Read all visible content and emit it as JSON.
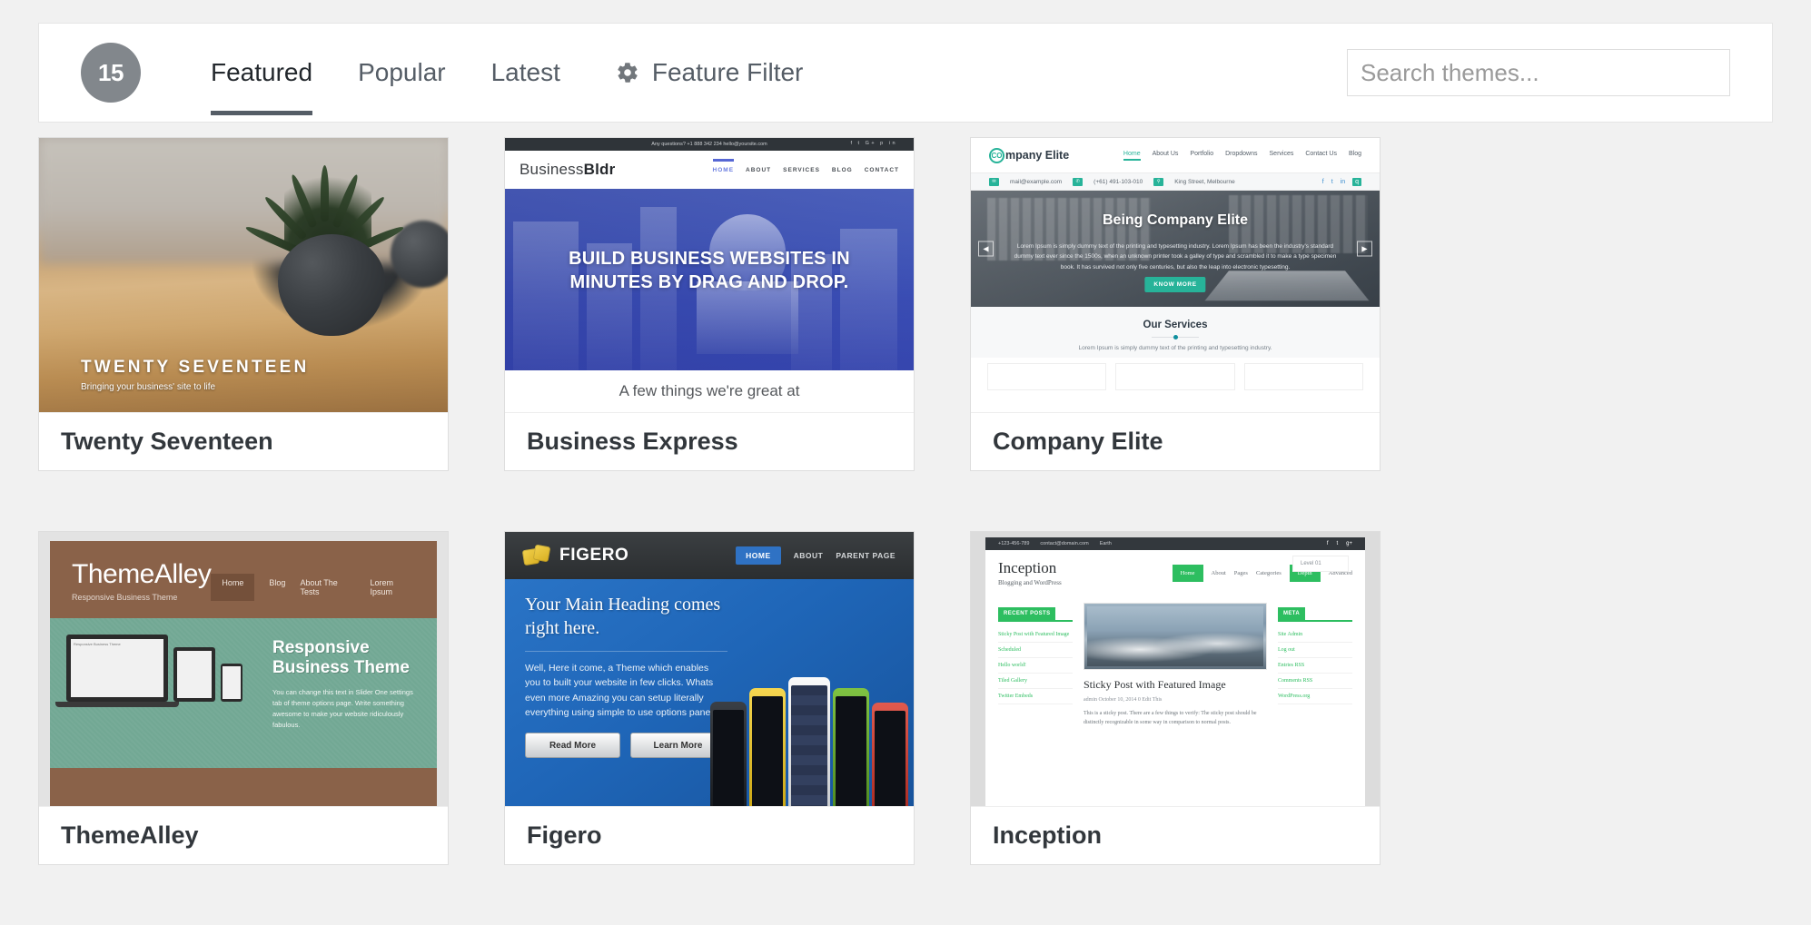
{
  "header": {
    "count": "15",
    "tabs": [
      {
        "label": "Featured",
        "active": true
      },
      {
        "label": "Popular",
        "active": false
      },
      {
        "label": "Latest",
        "active": false
      }
    ],
    "feature_filter_label": "Feature Filter",
    "gear_icon": "gear-icon",
    "search": {
      "value": "",
      "placeholder": "Search themes..."
    }
  },
  "themes": [
    {
      "name": "Twenty Seventeen",
      "preview": {
        "overlay_title": "TWENTY SEVENTEEN",
        "overlay_tagline": "Bringing your business' site to life"
      }
    },
    {
      "name": "Business Express",
      "preview": {
        "topbar": "Any questions?   +1 888 342 234    hello@yoursite.com",
        "social": "f  t  G+  p  in",
        "logo_light": "Business",
        "logo_bold": "Bldr",
        "nav": [
          "HOME",
          "ABOUT",
          "SERVICES",
          "BLOG",
          "CONTACT"
        ],
        "hero_line1": "BUILD BUSINESS WEBSITES IN",
        "hero_line2": "MINUTES BY DRAG AND DROP.",
        "subheading": "A few things we're great at"
      }
    },
    {
      "name": "Company Elite",
      "preview": {
        "logo_badge": "CO",
        "logo_rest": "mpany Elite",
        "nav": [
          "Home",
          "About Us",
          "Portfolio",
          "Dropdowns",
          "Services",
          "Contact Us",
          "Blog"
        ],
        "info_email": "mail@example.com",
        "info_phone": "(+61) 491-103-010",
        "info_address": "King Street, Melbourne",
        "hero_title": "Being Company Elite",
        "hero_body": "Lorem Ipsum is simply dummy text of the printing and typesetting industry. Lorem Ipsum has been the industry's standard dummy text ever since the 1500s, when an unknown printer took a galley of type and scrambled it to make a type specimen book. It has survived not only five centuries, but also the leap into electronic typesetting.",
        "hero_button": "KNOW MORE",
        "arrow_prev": "◀",
        "arrow_next": "▶",
        "services_title": "Our Services",
        "services_body": "Lorem Ipsum is simply dummy text of the printing and typesetting industry."
      }
    },
    {
      "name": "ThemeAlley",
      "preview": {
        "logo": "ThemeAlley",
        "tagline": "Responsive Business Theme",
        "nav": [
          "Home",
          "Blog",
          "About The Tests",
          "Lorem Ipsum"
        ],
        "slide_title_1": "Responsive",
        "slide_title_2": "Business Theme",
        "slide_body": "You can change this text in Slider One settings tab of theme options page. Write something awesome to make your website ridiculously fabulous.",
        "device_label": "Responsive Business Theme"
      }
    },
    {
      "name": "Figero",
      "preview": {
        "brand": "FIGERO",
        "nav": [
          "HOME",
          "ABOUT",
          "PARENT PAGE"
        ],
        "hero_line1": "Your Main Heading comes",
        "hero_line2": "right here.",
        "hero_body": "Well, Here it come, a Theme which enables you to built your website in few clicks. Whats even more Amazing you can setup literally everything using simple to use options panel.",
        "btn_primary": "Read More",
        "btn_secondary": "Learn More"
      }
    },
    {
      "name": "Inception",
      "preview": {
        "topbar_phone": "+123-456-789",
        "topbar_email": "contact@domain.com",
        "topbar_location": "Earth",
        "logo": "Inception",
        "logo_sub": "Blogging and WordPress",
        "nav": [
          "Home",
          "About",
          "Pages",
          "Categories",
          "Depth",
          "Advanced"
        ],
        "dropdown_item": "Level 01",
        "widget_recent_title": "RECENT POSTS",
        "recent_posts": [
          "Sticky Post with Featured Image",
          "Scheduled",
          "Hello world!",
          "Tiled Gallery",
          "Twitter Embeds"
        ],
        "widget_meta_title": "META",
        "meta_items": [
          "Site Admin",
          "Log out",
          "Entries RSS",
          "Comments RSS",
          "WordPress.org"
        ],
        "post_title": "Sticky Post with Featured Image",
        "post_meta": "admin    October 10, 2014    0    Edit This",
        "post_excerpt": "This is a sticky post. There are a few things to verify: The sticky post should be distinctly recognizable in some way in comparison to normal posts."
      }
    }
  ],
  "colors": {
    "page_bg": "#f1f1f1",
    "card_bg": "#ffffff",
    "badge_bg": "#82878c",
    "text_dark": "#32373c",
    "text_muted": "#555d66",
    "accent_teal": "#27b399",
    "accent_green": "#2dbe60",
    "accent_blue": "#2f72c4"
  }
}
